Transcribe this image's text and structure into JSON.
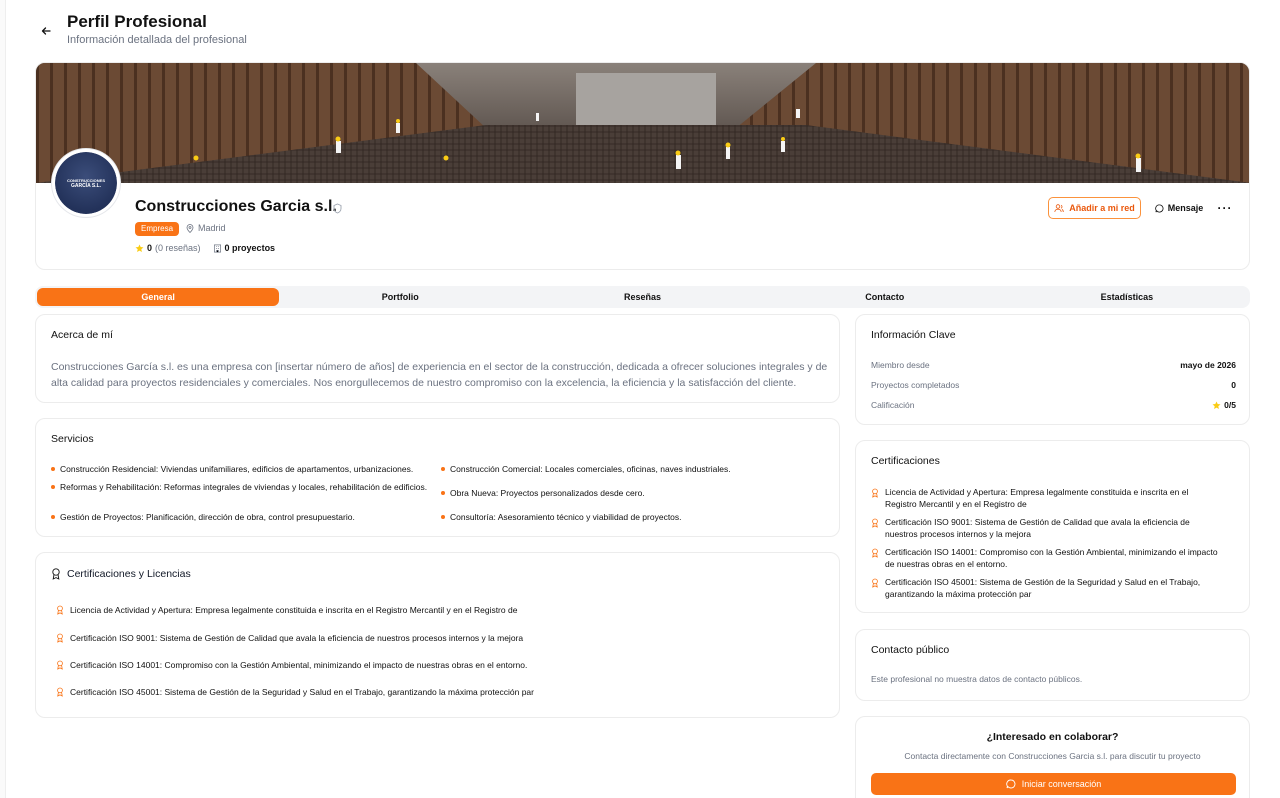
{
  "header": {
    "title": "Perfil Profesional",
    "subtitle": "Información detallada del profesional"
  },
  "profile": {
    "name": "Construcciones Garcia s.l.",
    "badge": "Empresa",
    "location": "Madrid",
    "rating_value": "0",
    "rating_reviews": "(0 reseñas)",
    "projects": "0 proyectos",
    "logo_line1": "CONSTRUCCIONES",
    "logo_line2": "GARCÍA S.L.",
    "actions": {
      "add_network": "Añadir a mi red",
      "message": "Mensaje",
      "more": "···"
    }
  },
  "tabs": [
    {
      "label": "General",
      "active": true
    },
    {
      "label": "Portfolio",
      "active": false
    },
    {
      "label": "Reseñas",
      "active": false
    },
    {
      "label": "Contacto",
      "active": false
    },
    {
      "label": "Estadísticas",
      "active": false
    }
  ],
  "about": {
    "title": "Acerca de mí",
    "text": "Construcciones García s.l. es una empresa con [insertar número de años] de experiencia en el sector de la construcción, dedicada a ofrecer soluciones integrales y de alta calidad para proyectos residenciales y comerciales. Nos enorgullecemos de nuestro compromiso con la excelencia, la eficiencia y la satisfacción del cliente."
  },
  "services": {
    "title": "Servicios",
    "items": [
      "Construcción Residencial: Viviendas unifamiliares, edificios de apartamentos, urbanizaciones.",
      "Construcción Comercial: Locales comerciales, oficinas, naves industriales.",
      "Reformas y Rehabilitación: Reformas integrales de viviendas y locales, rehabilitación de edificios.",
      "Obra Nueva: Proyectos personalizados desde cero.",
      "Gestión de Proyectos: Planificación, dirección de obra, control presupuestario.",
      "Consultoría: Asesoramiento técnico y viabilidad de proyectos."
    ]
  },
  "certifications_main": {
    "title": "Certificaciones y Licencias",
    "items": [
      "Licencia de Actividad y Apertura: Empresa legalmente constituida e inscrita en el Registro Mercantil y en el Registro de",
      "Certificación ISO 9001: Sistema de Gestión de Calidad que avala la eficiencia de nuestros procesos internos y la mejora",
      "Certificación ISO 14001: Compromiso con la Gestión Ambiental, minimizando el impacto de nuestras obras en el entorno.",
      "Certificación ISO 45001: Sistema de Gestión de la Seguridad y Salud en el Trabajo, garantizando la máxima protección par"
    ]
  },
  "key_info": {
    "title": "Información Clave",
    "rows": [
      {
        "label": "Miembro desde",
        "value": "mayo de 2026"
      },
      {
        "label": "Proyectos completados",
        "value": "0"
      },
      {
        "label": "Calificación",
        "value": "0/5"
      }
    ]
  },
  "certifications_side": {
    "title": "Certificaciones",
    "items": [
      "Licencia de Actividad y Apertura: Empresa legalmente constituida e inscrita en el Registro Mercantil y en el Registro de",
      "Certificación ISO 9001: Sistema de Gestión de Calidad que avala la eficiencia de nuestros procesos internos y la mejora",
      "Certificación ISO 14001: Compromiso con la Gestión Ambiental, minimizando el impacto de nuestras obras en el entorno.",
      "Certificación ISO 45001: Sistema de Gestión de la Seguridad y Salud en el Trabajo, garantizando la máxima protección par"
    ]
  },
  "public_contact": {
    "title": "Contacto público",
    "note": "Este profesional no muestra datos de contacto públicos."
  },
  "cta": {
    "title": "¿Interesado en colaborar?",
    "subtitle": "Contacta directamente con Construcciones Garcia s.l. para discutir tu proyecto",
    "button": "Iniciar conversación"
  },
  "colors": {
    "accent": "#f97316",
    "star": "#facc15"
  }
}
